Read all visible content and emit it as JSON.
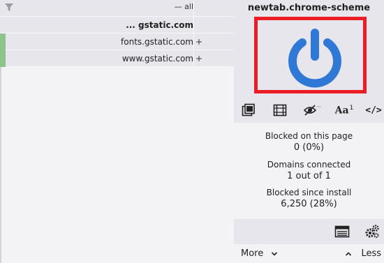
{
  "firewall": {
    "header": {
      "all_label": "all"
    },
    "rows": [
      {
        "domain": "... gstatic.com",
        "action": ""
      },
      {
        "domain": "fonts.gstatic.com",
        "action": "+"
      },
      {
        "domain": "www.gstatic.com",
        "action": "+"
      }
    ]
  },
  "popup": {
    "hostname": "newtab.chrome-scheme",
    "power_icon": "power-icon",
    "tools": [
      {
        "icon": "popup-blocker-icon"
      },
      {
        "icon": "media-element-icon"
      },
      {
        "icon": "cosmetic-filter-eye-icon"
      },
      {
        "icon": "remote-fonts-icon",
        "label": "Aa",
        "badge": "1"
      },
      {
        "icon": "javascript-code-icon",
        "label": "</>"
      }
    ],
    "stats": {
      "blocked_page_label": "Blocked on this page",
      "blocked_page_value": "0 (0%)",
      "domains_label": "Domains connected",
      "domains_value": "1 out of 1",
      "blocked_install_label": "Blocked since install",
      "blocked_install_value": "6,250 (28%)"
    },
    "more_label": "More",
    "less_label": "Less"
  },
  "colors": {
    "power_blue": "#2f78d6",
    "highlight_red": "#ec1c24",
    "row_bg": "#e6e6ec",
    "allowed_green": "#8ec38b"
  }
}
